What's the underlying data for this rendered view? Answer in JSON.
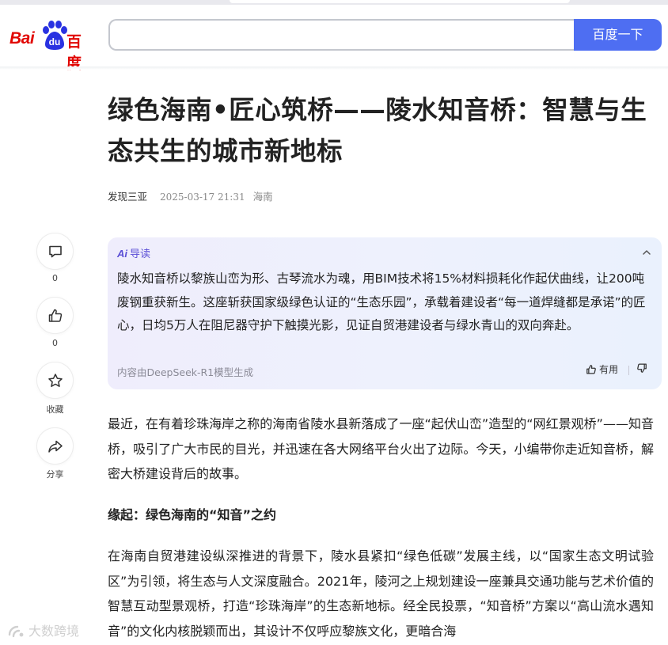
{
  "header": {
    "logo": {
      "latin": "Bai",
      "paw_text": "du",
      "chinese": "百度"
    },
    "search": {
      "value": "",
      "placeholder": ""
    },
    "search_button": "百度一下"
  },
  "article": {
    "title": "绿色海南•匠心筑桥——陵水知音桥：智慧与生态共生的城市新地标",
    "author": "发现三亚",
    "date": "2025-03-17 21:31",
    "location": "海南"
  },
  "rail": {
    "comment_count": "0",
    "like_count": "0",
    "favorite_label": "收藏",
    "share_label": "分享"
  },
  "ai_summary": {
    "logo": "Ai",
    "label": "导读",
    "text": "陵水知音桥以黎族山峦为形、古琴流水为魂，用BIM技术将15%材料损耗化作起伏曲线，让200吨废钢重获新生。这座斩获国家级绿色认证的“生态乐园”，承载着建设者“每一道焊缝都是承诺”的匠心，日均5万人在阻尼器守护下触摸光影，见证自贸港建设者与绿水青山的双向奔赴。",
    "footer": "内容由DeepSeek-R1模型生成",
    "useful_label": "有用"
  },
  "body": {
    "para1": "最近，在有着珍珠海岸之称的海南省陵水县新落成了一座“起伏山峦”造型的“网红景观桥”——知音桥，吸引了广大市民的目光，并迅速在各大网络平台火出了边际。今天，小编带你走近知音桥，解密大桥建设背后的故事。",
    "subhead": "缘起：绿色海南的“知音”之约",
    "para2": "在海南自贸港建设纵深推进的背景下，陵水县紧扣“绿色低碳”发展主线，以“国家生态文明试验区”为引领，将生态与人文深度融合。2021年，陵河之上规划建设一座兼具交通功能与艺术价值的智慧互动型景观桥，打造“珍珠海岸”的生态新地标。经全民投票，“知音桥”方案以“高山流水遇知音”的文化内核脱颖而出，其设计不仅呼应黎族文化，更暗合海"
  },
  "watermark": {
    "text": "大数跨境"
  },
  "colors": {
    "brand_red": "#e10602",
    "search_blue": "#4e6ef2",
    "ai_purple": "#5b4fd6",
    "text": "#222222"
  }
}
